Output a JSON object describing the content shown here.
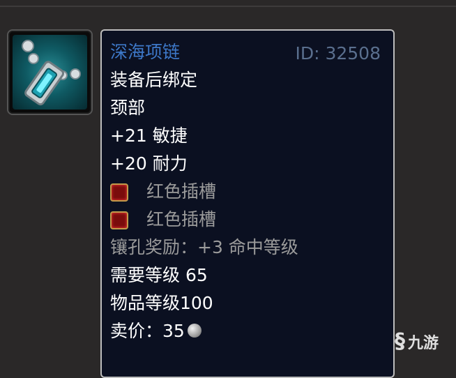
{
  "item": {
    "name": "深海项链",
    "id_label": "ID: 32508",
    "binding": "装备后绑定",
    "slot": "颈部",
    "stats": [
      "+21 敏捷",
      "+20 耐力"
    ],
    "sockets": [
      {
        "label": "红色插槽",
        "icon": "red-socket-icon",
        "color": "#7a0c0c"
      },
      {
        "label": "红色插槽",
        "icon": "red-socket-icon",
        "color": "#7a0c0c"
      }
    ],
    "socket_bonus": "镶孔奖励：+3 命中等级",
    "required_level": "需要等级 65",
    "item_level": "物品等级100",
    "sell_price": "卖价：35",
    "sell_currency_icon": "silver-coin-icon",
    "icon": "necklace-icon"
  },
  "colors": {
    "name": "#3d78c8",
    "id": "#5a6f8e",
    "primary_text": "#ffffff",
    "secondary_text": "#9b9b9b",
    "tooltip_bg": "#0b1021",
    "page_bg": "#2a2828"
  },
  "watermark": {
    "text": "九游",
    "icon": "jiuyou-logo-icon"
  }
}
